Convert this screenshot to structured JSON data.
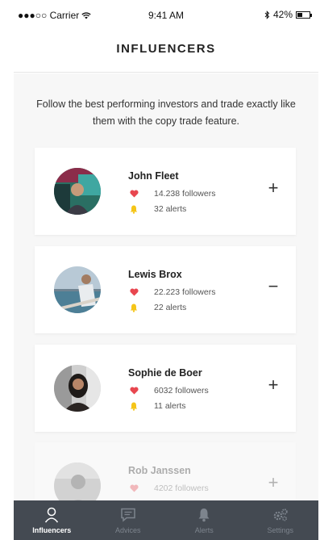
{
  "status_bar": {
    "carrier": "●●●○○ Carrier",
    "time": "9:41 AM",
    "battery_text": "42%",
    "battery_level": 0.42
  },
  "header": {
    "title": "INFLUENCERS"
  },
  "intro": "Follow the best performing investors and trade exactly like them with the copy trade feature.",
  "influencers": [
    {
      "name": "John Fleet",
      "followers": "14.238 followers",
      "alerts": "32 alerts",
      "action": "+"
    },
    {
      "name": "Lewis Brox",
      "followers": "22.223 followers",
      "alerts": "22 alerts",
      "action": "−"
    },
    {
      "name": "Sophie de Boer",
      "followers": "6032 followers",
      "alerts": "11 alerts",
      "action": "+"
    },
    {
      "name": "Rob Janssen",
      "followers": "4202 followers",
      "alerts": "",
      "action": "+"
    }
  ],
  "tabs": [
    {
      "label": "Influencers",
      "icon": "user-icon",
      "active": true
    },
    {
      "label": "Advices",
      "icon": "chat-icon",
      "active": false
    },
    {
      "label": "Alerts",
      "icon": "bell-icon",
      "active": false
    },
    {
      "label": "Settings",
      "icon": "gears-icon",
      "active": false
    }
  ],
  "colors": {
    "heart": "#e8464f",
    "bell": "#f5c518",
    "tabbar": "#444a52",
    "tab_active": "#ffffff",
    "tab_inactive": "#7d848d"
  }
}
